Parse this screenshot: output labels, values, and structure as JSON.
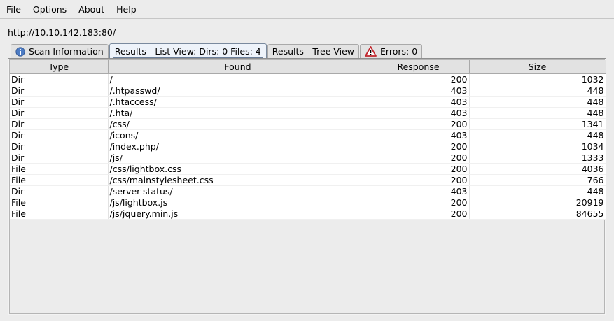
{
  "menu": [
    "File",
    "Options",
    "About",
    "Help"
  ],
  "url": "http://10.10.142.183:80/",
  "tabs": [
    {
      "label": "Scan Information",
      "icon": "info-icon"
    },
    {
      "label": "Results - List View: Dirs: 0 Files: 4",
      "active": true
    },
    {
      "label": "Results - Tree View"
    },
    {
      "label": "Errors: 0",
      "icon": "warning-icon"
    }
  ],
  "table": {
    "columns": [
      "Type",
      "Found",
      "Response",
      "Size"
    ],
    "rows": [
      [
        "Dir",
        "/",
        "200",
        "1032"
      ],
      [
        "Dir",
        "/.htpasswd/",
        "403",
        "448"
      ],
      [
        "Dir",
        "/.htaccess/",
        "403",
        "448"
      ],
      [
        "Dir",
        "/.hta/",
        "403",
        "448"
      ],
      [
        "Dir",
        "/css/",
        "200",
        "1341"
      ],
      [
        "Dir",
        "/icons/",
        "403",
        "448"
      ],
      [
        "Dir",
        "/index.php/",
        "200",
        "1034"
      ],
      [
        "Dir",
        "/js/",
        "200",
        "1333"
      ],
      [
        "File",
        "/css/lightbox.css",
        "200",
        "4036"
      ],
      [
        "File",
        "/css/mainstylesheet.css",
        "200",
        "766"
      ],
      [
        "Dir",
        "/server-status/",
        "403",
        "448"
      ],
      [
        "File",
        "/js/lightbox.js",
        "200",
        "20919"
      ],
      [
        "File",
        "/js/jquery.min.js",
        "200",
        "84655"
      ]
    ]
  }
}
